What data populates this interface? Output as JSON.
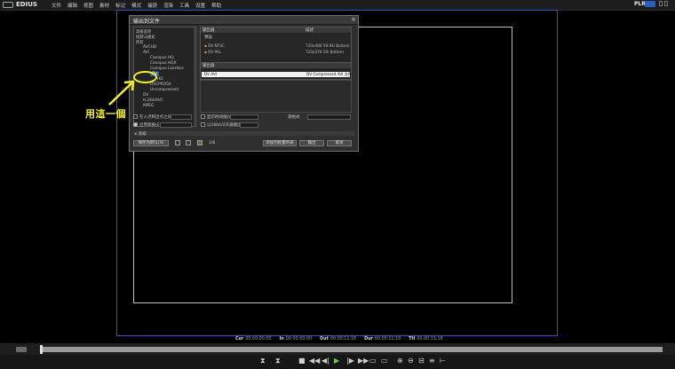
{
  "app": {
    "name": "EDIUS",
    "menu": [
      "文件",
      "编辑",
      "视图",
      "素材",
      "标记",
      "模式",
      "捕获",
      "渲染",
      "工具",
      "设置",
      "帮助"
    ],
    "mode_label": "PLR",
    "rec_color": "#2b5cc0"
  },
  "dialog": {
    "title": "输出到文件",
    "close": "×",
    "tree": {
      "items": [
        "高级选项",
        "按默认模式",
        "所有",
        "AVCHD",
        "AVI",
        "Canopus HQ",
        "Canopus HQX",
        "Canopus Lossless",
        "DV",
        "HD",
        "DVCPRO50",
        "Uncompressed",
        "DV",
        "H.264/AVC",
        "MPEG"
      ],
      "selected_index": 8
    },
    "presets": {
      "col_name": "输出器",
      "col_desc": "描述",
      "group": "预设",
      "rows": [
        {
          "name": "DV NTSC",
          "desc": "720x480 59.94i Bottom"
        },
        {
          "name": "DV PAL",
          "desc": "720x576 50i Bottom"
        }
      ]
    },
    "outputs": {
      "group": "输出器",
      "row": {
        "name": "DV AVI",
        "desc": "DV Compressed AVI 文件"
      }
    },
    "options": {
      "in_out_label": "在入点和出点之间输出(B)",
      "enable_convert_label": "启用转换(E)",
      "show_on_timeline_label": "显示时间线(V)",
      "progressive_label": "以16bit/2声道输出(C)",
      "field_label": "源格式"
    },
    "advanced_label": "高级",
    "buttons": {
      "save_preset": "保存为默认(S)",
      "add_to_batch": "添加到批量列表",
      "output": "输出",
      "cancel": "取消"
    },
    "icons_label": "1/8"
  },
  "annotation": {
    "text": "用這一個",
    "color": "#f2ef2c"
  },
  "timecodes": [
    {
      "label": "Cur",
      "value": "00:00:00;00"
    },
    {
      "label": "In",
      "value": "00:00:00;00"
    },
    {
      "label": "Out",
      "value": "00:00:11;18"
    },
    {
      "label": "Dur",
      "value": "00:00:11;18"
    },
    {
      "label": "Ttl",
      "value": "00:00:11;18"
    }
  ],
  "transport": {
    "buttons": [
      "⧗",
      "⧗",
      "■",
      "◀◀",
      "◀|",
      "▶",
      "|▶",
      "▶▶",
      "▭",
      "▭",
      "⊕",
      "⊖",
      "⊟",
      "≡",
      "⊢"
    ]
  }
}
